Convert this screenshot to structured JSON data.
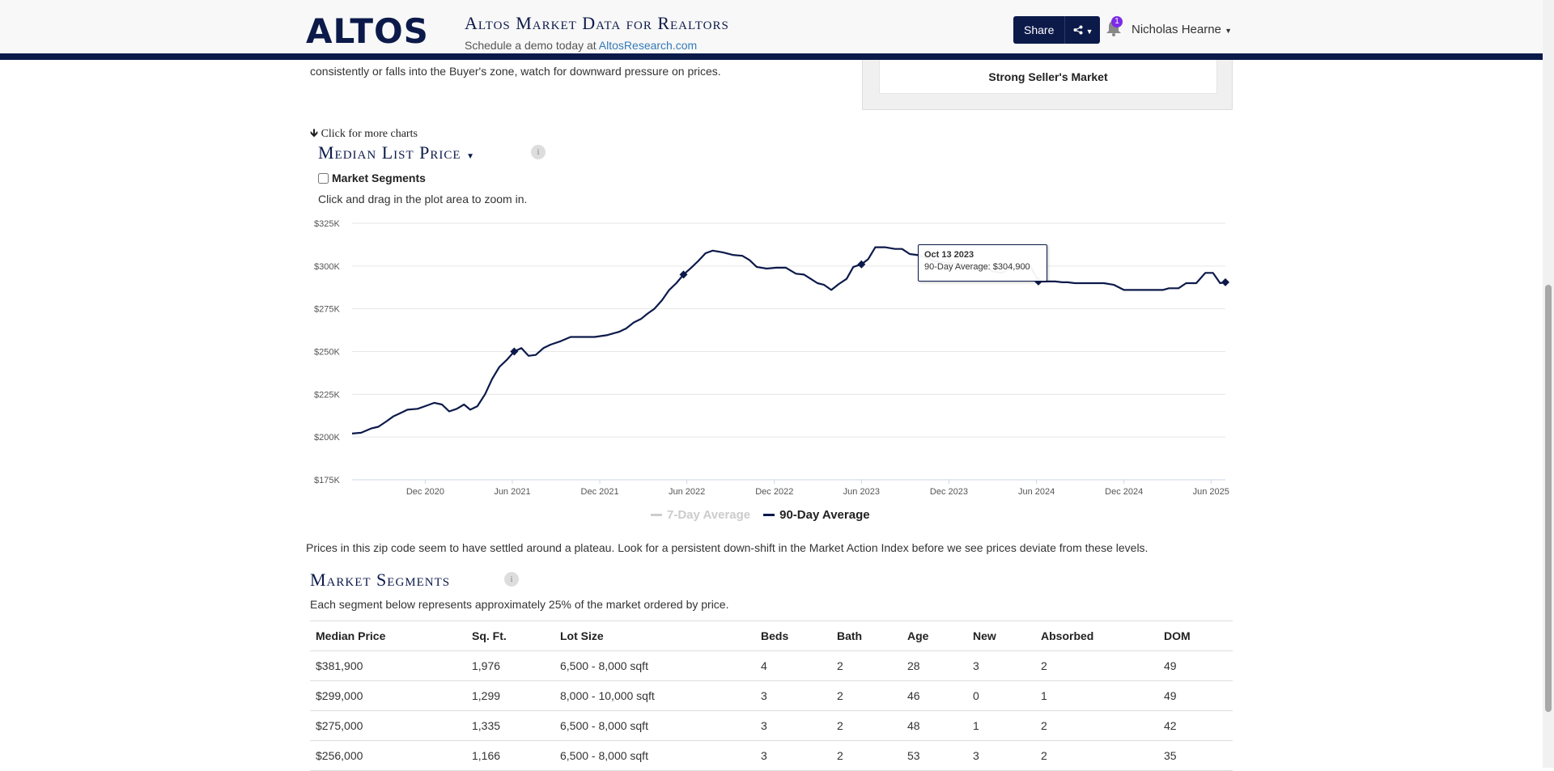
{
  "header": {
    "logo": "ALTOS",
    "title": "Altos Market Data for Realtors",
    "subtitle_prefix": "Schedule a demo today at ",
    "subtitle_link": "AltosResearch.com",
    "share_label": "Share",
    "notification_count": "1",
    "user_name": "Nicholas Hearne"
  },
  "market": {
    "intro_text": "consistently or falls into the Buyer's zone, watch for downward pressure on prices.",
    "status": "Strong Seller's Market"
  },
  "chart_section": {
    "more_charts": "Click for more charts",
    "title": "Median List Price",
    "segments_label": "Market Segments",
    "zoom_hint": "Click and drag in the plot area to zoom in.",
    "tooltip_date": "Oct 13 2023",
    "tooltip_value": "90-Day Average: $304,900",
    "commentary": "Prices in this zip code seem to have settled around a plateau. Look for a persistent down-shift in the Market Action Index before we see prices deviate from these levels."
  },
  "chart_data": {
    "type": "line",
    "title": "Median List Price",
    "y_ticks": [
      "$175K",
      "$200K",
      "$225K",
      "$250K",
      "$275K",
      "$300K",
      "$325K"
    ],
    "ylim": [
      175000,
      325000
    ],
    "x_ticks": [
      "Dec 2020",
      "Jun 2021",
      "Dec 2021",
      "Jun 2022",
      "Dec 2022",
      "Jun 2023",
      "Dec 2023",
      "Jun 2024",
      "Dec 2024",
      "Jun 2025"
    ],
    "legend": [
      {
        "name": "7-Day Average",
        "visible": false,
        "color": "#cccccc"
      },
      {
        "name": "90-Day Average",
        "visible": true,
        "color": "#0c1a4a"
      }
    ],
    "series": [
      {
        "name": "90-Day Average",
        "x": [
          "2020-07-01",
          "2020-07-20",
          "2020-08-10",
          "2020-08-25",
          "2020-09-10",
          "2020-09-25",
          "2020-10-10",
          "2020-10-25",
          "2020-11-15",
          "2020-12-05",
          "2020-12-20",
          "2021-01-05",
          "2021-01-20",
          "2021-02-05",
          "2021-02-20",
          "2021-03-05",
          "2021-03-20",
          "2021-04-05",
          "2021-04-20",
          "2021-05-05",
          "2021-05-20",
          "2021-06-05",
          "2021-06-20",
          "2021-07-05",
          "2021-07-20",
          "2021-08-05",
          "2021-08-20",
          "2021-09-10",
          "2021-10-01",
          "2021-10-25",
          "2021-11-20",
          "2021-12-15",
          "2022-01-10",
          "2022-01-25",
          "2022-02-10",
          "2022-02-25",
          "2022-03-10",
          "2022-03-25",
          "2022-04-10",
          "2022-04-25",
          "2022-05-10",
          "2022-05-25",
          "2022-06-10",
          "2022-06-25",
          "2022-07-10",
          "2022-07-25",
          "2022-08-15",
          "2022-09-05",
          "2022-09-25",
          "2022-10-10",
          "2022-10-25",
          "2022-11-15",
          "2022-12-05",
          "2022-12-25",
          "2023-01-15",
          "2023-02-01",
          "2023-02-15",
          "2023-03-01",
          "2023-03-15",
          "2023-03-30",
          "2023-04-15",
          "2023-05-01",
          "2023-05-15",
          "2023-06-01",
          "2023-06-15",
          "2023-06-30",
          "2023-07-20",
          "2023-08-10",
          "2023-08-25",
          "2023-09-10",
          "2023-09-25",
          "2023-10-13",
          "2023-11-01",
          "2023-11-20",
          "2023-12-10",
          "2024-01-01",
          "2024-01-20",
          "2024-02-10",
          "2024-03-01",
          "2024-03-20",
          "2024-04-10",
          "2024-05-01",
          "2024-05-20",
          "2024-06-05",
          "2024-06-20",
          "2024-07-10",
          "2024-07-25",
          "2024-08-05",
          "2024-08-20",
          "2024-09-10",
          "2024-10-01",
          "2024-10-20",
          "2024-11-10",
          "2024-12-01",
          "2024-12-20",
          "2025-01-10",
          "2025-02-01",
          "2025-02-20",
          "2025-03-05",
          "2025-03-25",
          "2025-04-10",
          "2025-05-01",
          "2025-05-20",
          "2025-06-05",
          "2025-06-20",
          "2025-07-01"
        ],
        "values": [
          202000,
          202500,
          205000,
          206000,
          209000,
          212000,
          214000,
          216000,
          216500,
          218500,
          220000,
          219000,
          215000,
          216500,
          219000,
          216000,
          218000,
          225000,
          234000,
          241000,
          245000,
          250000,
          252000,
          247500,
          248000,
          252000,
          254000,
          256000,
          258500,
          258500,
          258500,
          259500,
          261500,
          263500,
          267000,
          269000,
          272000,
          275000,
          280000,
          286000,
          290000,
          295000,
          299000,
          303000,
          307500,
          309000,
          308000,
          306500,
          306000,
          303500,
          299500,
          298500,
          299000,
          299000,
          295500,
          295000,
          292500,
          290000,
          289000,
          286000,
          289500,
          292500,
          299500,
          301000,
          304000,
          311000,
          311000,
          310000,
          310000,
          307000,
          306500,
          304900,
          303000,
          302000,
          301500,
          301000,
          300500,
          300000,
          297000,
          296000,
          299000,
          299000,
          299500,
          291000,
          291000,
          291000,
          290500,
          290500,
          290000,
          290000,
          290000,
          290000,
          289000,
          286000,
          286000,
          286000,
          286000,
          286000,
          287000,
          287000,
          290000,
          290000,
          296000,
          296000,
          290000,
          290500
        ]
      }
    ]
  },
  "segments": {
    "title": "Market Segments",
    "description": "Each segment below represents approximately 25% of the market ordered by price.",
    "columns": [
      "Median Price",
      "Sq. Ft.",
      "Lot Size",
      "Beds",
      "Bath",
      "Age",
      "New",
      "Absorbed",
      "DOM"
    ],
    "rows": [
      [
        "$381,900",
        "1,976",
        "6,500 - 8,000 sqft",
        "4",
        "2",
        "28",
        "3",
        "2",
        "49"
      ],
      [
        "$299,000",
        "1,299",
        "8,000 - 10,000 sqft",
        "3",
        "2",
        "46",
        "0",
        "1",
        "49"
      ],
      [
        "$275,000",
        "1,335",
        "6,500 - 8,000 sqft",
        "3",
        "2",
        "48",
        "1",
        "2",
        "42"
      ],
      [
        "$256,000",
        "1,166",
        "6,500 - 8,000 sqft",
        "3",
        "2",
        "53",
        "3",
        "2",
        "35"
      ]
    ]
  }
}
